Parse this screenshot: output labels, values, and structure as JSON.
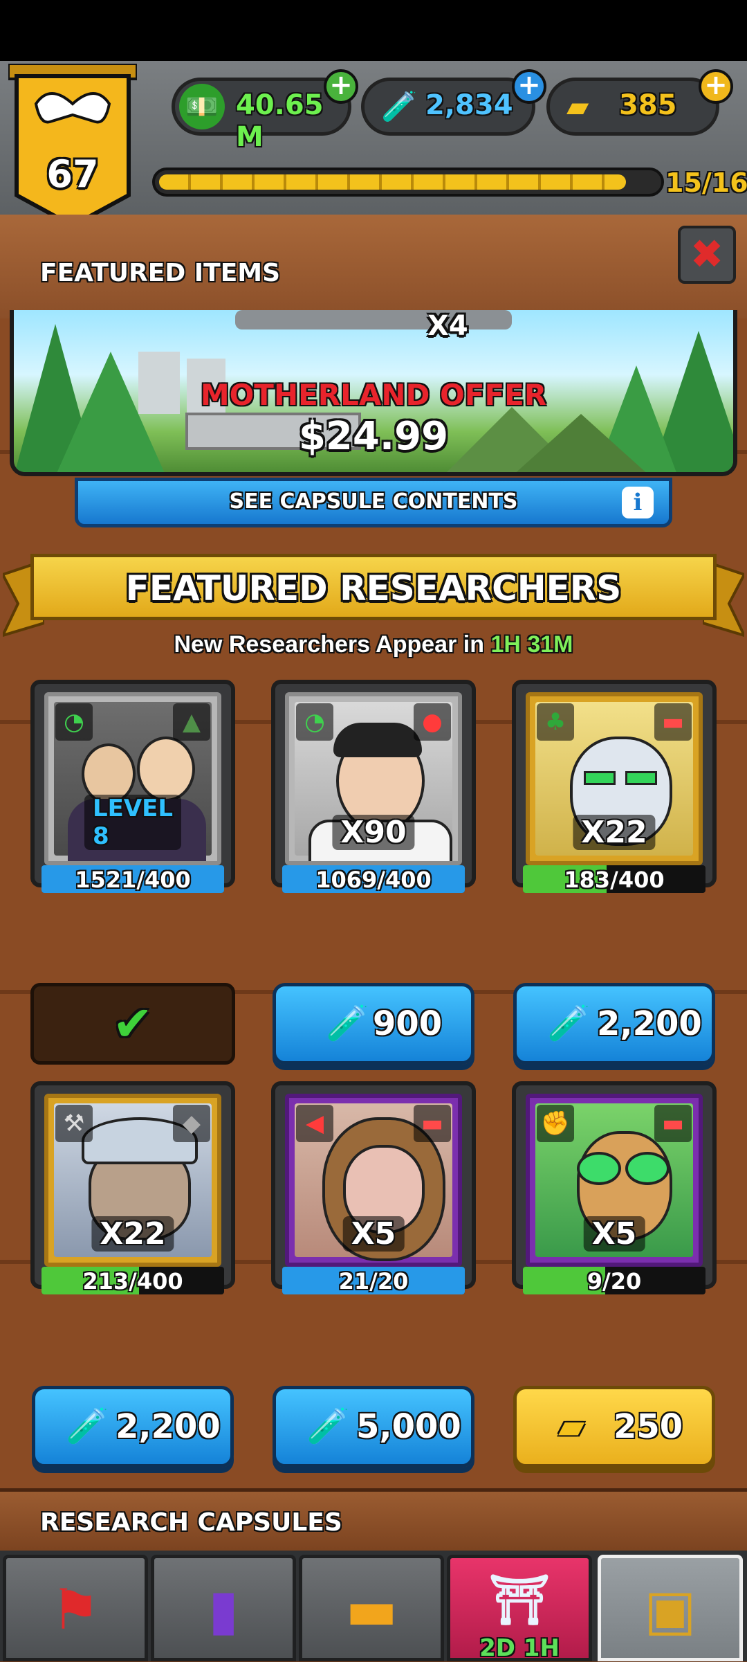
{
  "header": {
    "level": "67",
    "currency_cash": "40.65 M",
    "currency_flask": "2,834",
    "currency_gold": "385",
    "xp_progress": "15/16",
    "xp_fraction": 0.9375
  },
  "featured_items": {
    "title": "FEATURED ITEMS",
    "offer_partial": "X4",
    "offer_name": "MOTHERLAND OFFER",
    "offer_price": "$24.99",
    "capsule_button": "SEE CAPSULE CONTENTS",
    "info_icon": "i"
  },
  "researchers": {
    "title": "FEATURED RESEARCHERS",
    "timer_prefix": "New Researchers Appear in",
    "timer_value": "1H 31M",
    "cards": [
      {
        "count": "LEVEL 8",
        "progress": "1521/400",
        "fill": 1.0,
        "button": "",
        "button_type": "owned"
      },
      {
        "count": "X90",
        "progress": "1069/400",
        "fill": 1.0,
        "button": "900",
        "button_type": "flask"
      },
      {
        "count": "X22",
        "progress": "183/400",
        "fill": 0.4575,
        "button": "2,200",
        "button_type": "flask"
      },
      {
        "count": "X22",
        "progress": "213/400",
        "fill": 0.5325,
        "button": "2,200",
        "button_type": "flask"
      },
      {
        "count": "X5",
        "progress": "21/20",
        "fill": 1.0,
        "button": "5,000",
        "button_type": "flask"
      },
      {
        "count": "X5",
        "progress": "9/20",
        "fill": 0.45,
        "button": "250",
        "button_type": "gold"
      }
    ]
  },
  "capsules": {
    "title": "RESEARCH CAPSULES"
  },
  "nav": {
    "event_timer": "2D 1H"
  },
  "colors": {
    "accent_blue": "#1e8fe6",
    "gold": "#f2c01e",
    "green_text": "#5de05a"
  }
}
